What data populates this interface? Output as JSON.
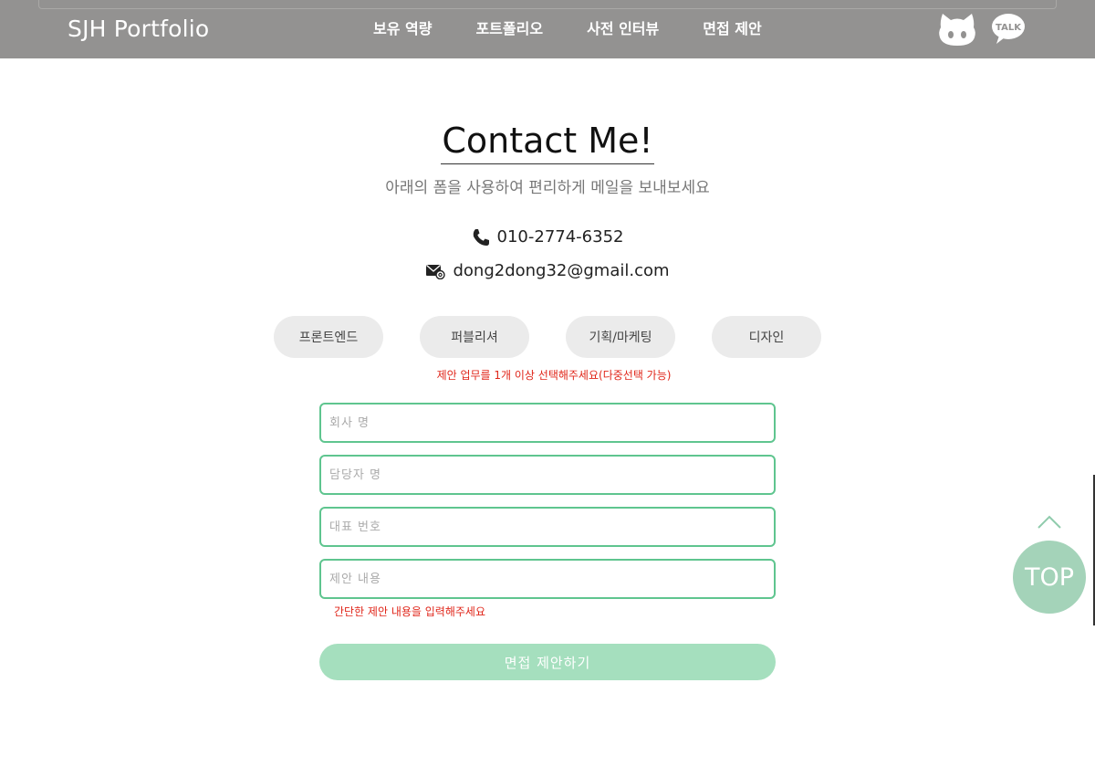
{
  "header": {
    "logo": "SJH Portfolio",
    "nav": [
      "보유 역량",
      "포트폴리오",
      "사전 인터뷰",
      "면접 제안"
    ],
    "icons": [
      "github-icon",
      "kakao-talk-icon"
    ]
  },
  "contact": {
    "title": "Contact Me!",
    "subtitle": "아래의 폼을 사용하여 편리하게 메일을 보내보세요",
    "phone": "010-2774-6352",
    "email": "dong2dong32@gmail.com",
    "phone_icon": "phone-icon",
    "email_icon": "mail-icon"
  },
  "form": {
    "tags": [
      "프론트엔드",
      "퍼블리셔",
      "기획/마케팅",
      "디자인"
    ],
    "tags_warning": "제안 업무를 1개 이상 선택해주세요(다중선택 가능)",
    "company_placeholder": "회사 명",
    "manager_placeholder": "담당자 명",
    "phone_placeholder": "대표 번호",
    "content_placeholder": "제안 내용",
    "content_warning": "간단한 제안 내용을 입력해주세요",
    "submit_label": "면접 제안하기"
  },
  "top_button": {
    "label": "TOP",
    "arrow_icon": "chevron-up-icon"
  },
  "colors": {
    "header_bg": "#939291",
    "accent_green": "#5fc58f",
    "submit_bg": "#a5dfbe",
    "top_bg": "#a4d3b9",
    "warning_red": "#e0261a"
  }
}
